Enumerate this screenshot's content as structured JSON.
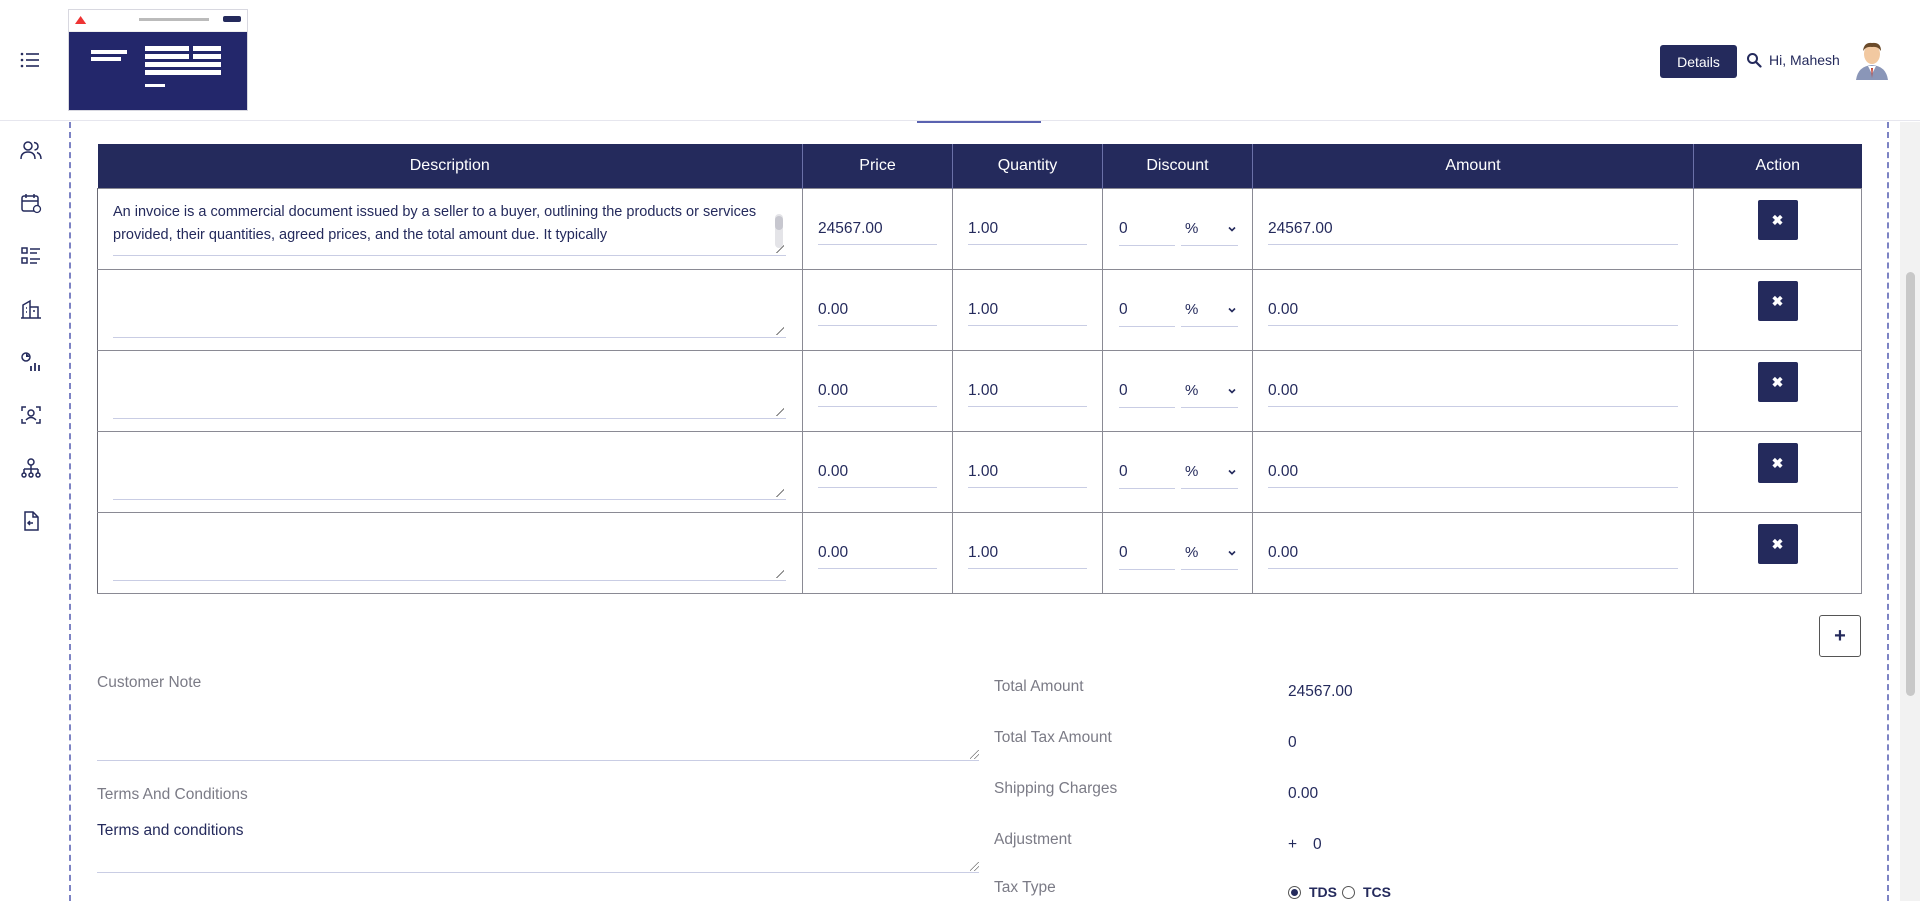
{
  "header": {
    "details_label": "Details",
    "greeting": "Hi, Mahesh"
  },
  "sidebar": {
    "items": [
      "users-icon",
      "calendar-icon",
      "list-icon",
      "building-icon",
      "chart-icon",
      "scan-user-icon",
      "org-chart-icon",
      "document-icon"
    ]
  },
  "table": {
    "columns": [
      "Description",
      "Price",
      "Quantity",
      "Discount",
      "Amount",
      "Action"
    ],
    "rows": [
      {
        "description": "An invoice is a commercial document issued by a seller to a buyer, outlining the products or services provided, their quantities, agreed prices, and the total amount due. It typically",
        "price": "24567.00",
        "quantity": "1.00",
        "discount": "0",
        "discount_type": "%",
        "amount": "24567.00"
      },
      {
        "description": "",
        "price": "0.00",
        "quantity": "1.00",
        "discount": "0",
        "discount_type": "%",
        "amount": "0.00"
      },
      {
        "description": "",
        "price": "0.00",
        "quantity": "1.00",
        "discount": "0",
        "discount_type": "%",
        "amount": "0.00"
      },
      {
        "description": "",
        "price": "0.00",
        "quantity": "1.00",
        "discount": "0",
        "discount_type": "%",
        "amount": "0.00"
      },
      {
        "description": "",
        "price": "0.00",
        "quantity": "1.00",
        "discount": "0",
        "discount_type": "%",
        "amount": "0.00"
      }
    ],
    "delete_icon": "✖",
    "add_row_icon": "+"
  },
  "notes": {
    "customer_note_label": "Customer Note",
    "customer_note_value": "",
    "terms_label": "Terms And Conditions",
    "terms_value": "Terms and conditions"
  },
  "summary": {
    "total_amount_label": "Total Amount",
    "total_amount_value": "24567.00",
    "total_tax_label": "Total Tax Amount",
    "total_tax_value": "0",
    "shipping_label": "Shipping Charges",
    "shipping_value": "0.00",
    "adjustment_label": "Adjustment",
    "adjustment_sign": "+",
    "adjustment_value": "0",
    "tax_type_label": "Tax Type",
    "tax_type_options": [
      "TDS",
      "TCS"
    ],
    "tax_type_selected": "TDS"
  },
  "colors": {
    "primary": "#242a5c",
    "text": "#242a5c",
    "label": "#7b7b86"
  }
}
